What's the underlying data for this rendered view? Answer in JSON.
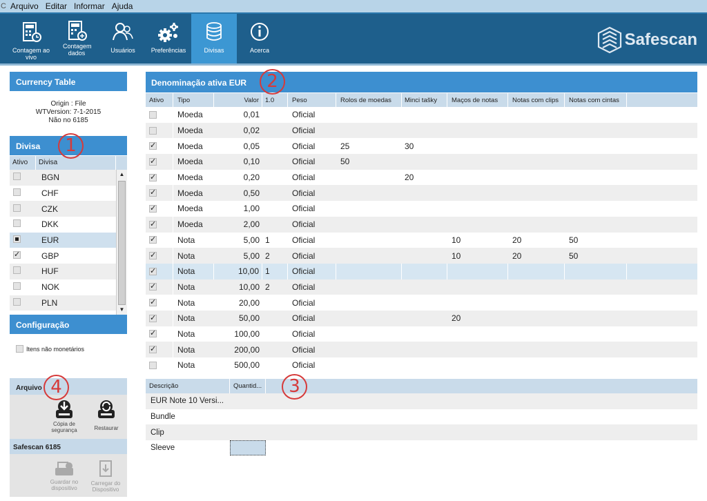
{
  "menu": {
    "left_fragment": "C",
    "items": [
      "Arquivo",
      "Editar",
      "Informar",
      "Ajuda"
    ]
  },
  "toolbar": {
    "buttons": [
      {
        "label": "Contagem ao vivo",
        "icon": "calculator-clock-icon"
      },
      {
        "label": "Contagem dados",
        "icon": "calculator-plus-icon"
      },
      {
        "label": "Usuários",
        "icon": "users-icon"
      },
      {
        "label": "Preferências",
        "icon": "gears-icon"
      },
      {
        "label": "Divisas",
        "icon": "coin-stack-icon",
        "active": true
      },
      {
        "label": "Acerca",
        "icon": "info-icon"
      }
    ],
    "logo": "Safescan"
  },
  "left": {
    "currency_table_title": "Currency Table",
    "origin": "Origin : File",
    "wtversion": "WTVersion: 7-1-2015",
    "serial": "Não no 6185",
    "divisa_title": "Divisa",
    "divisa_headers": [
      "Ativo",
      "Divisa"
    ],
    "divisas": [
      {
        "code": "BGN",
        "state": "off"
      },
      {
        "code": "CHF",
        "state": "off"
      },
      {
        "code": "CZK",
        "state": "off"
      },
      {
        "code": "DKK",
        "state": "off"
      },
      {
        "code": "EUR",
        "state": "square"
      },
      {
        "code": "GBP",
        "state": "on"
      },
      {
        "code": "HUF",
        "state": "off"
      },
      {
        "code": "NOK",
        "state": "off"
      },
      {
        "code": "PLN",
        "state": "off"
      }
    ],
    "config_title": "Configuração",
    "config_item": "Itens não monetários",
    "arquivo_title": "Arquivo",
    "backup_label": "Cópia de segurança",
    "restore_label": "Restaurar",
    "device_title": "Safescan 6185",
    "save_device_label": "Guardar no dispositivo",
    "load_device_label": "Carregar do Dispositivo"
  },
  "denom": {
    "title": "Denominação ativa EUR",
    "headers": [
      "Ativo",
      "Tipo",
      "Valor",
      "1.0",
      "Peso",
      "Rolos de moedas",
      "Minci tašky",
      "Maços de notas",
      "Notas com clips",
      "Notas com cintas"
    ],
    "rows": [
      {
        "active": false,
        "tipo": "Moeda",
        "valor": "0,01",
        "v10": "",
        "peso": "Oficial",
        "rolos": "",
        "minci": "",
        "macos": "",
        "clips": "",
        "cintas": ""
      },
      {
        "active": false,
        "tipo": "Moeda",
        "valor": "0,02",
        "v10": "",
        "peso": "Oficial",
        "rolos": "",
        "minci": "",
        "macos": "",
        "clips": "",
        "cintas": ""
      },
      {
        "active": true,
        "tipo": "Moeda",
        "valor": "0,05",
        "v10": "",
        "peso": "Oficial",
        "rolos": "25",
        "minci": "30",
        "macos": "",
        "clips": "",
        "cintas": ""
      },
      {
        "active": true,
        "tipo": "Moeda",
        "valor": "0,10",
        "v10": "",
        "peso": "Oficial",
        "rolos": "50",
        "minci": "",
        "macos": "",
        "clips": "",
        "cintas": ""
      },
      {
        "active": true,
        "tipo": "Moeda",
        "valor": "0,20",
        "v10": "",
        "peso": "Oficial",
        "rolos": "",
        "minci": "20",
        "macos": "",
        "clips": "",
        "cintas": ""
      },
      {
        "active": true,
        "tipo": "Moeda",
        "valor": "0,50",
        "v10": "",
        "peso": "Oficial",
        "rolos": "",
        "minci": "",
        "macos": "",
        "clips": "",
        "cintas": ""
      },
      {
        "active": true,
        "tipo": "Moeda",
        "valor": "1,00",
        "v10": "",
        "peso": "Oficial",
        "rolos": "",
        "minci": "",
        "macos": "",
        "clips": "",
        "cintas": ""
      },
      {
        "active": true,
        "tipo": "Moeda",
        "valor": "2,00",
        "v10": "",
        "peso": "Oficial",
        "rolos": "",
        "minci": "",
        "macos": "",
        "clips": "",
        "cintas": ""
      },
      {
        "active": true,
        "tipo": "Nota",
        "valor": "5,00",
        "v10": "1",
        "peso": "Oficial",
        "rolos": "",
        "minci": "",
        "macos": "10",
        "clips": "20",
        "cintas": "50"
      },
      {
        "active": true,
        "tipo": "Nota",
        "valor": "5,00",
        "v10": "2",
        "peso": "Oficial",
        "rolos": "",
        "minci": "",
        "macos": "10",
        "clips": "20",
        "cintas": "50"
      },
      {
        "active": true,
        "tipo": "Nota",
        "valor": "10,00",
        "v10": "1",
        "peso": "Oficial",
        "rolos": "",
        "minci": "",
        "macos": "",
        "clips": "",
        "cintas": "",
        "selected": true
      },
      {
        "active": true,
        "tipo": "Nota",
        "valor": "10,00",
        "v10": "2",
        "peso": "Oficial",
        "rolos": "",
        "minci": "",
        "macos": "",
        "clips": "",
        "cintas": ""
      },
      {
        "active": true,
        "tipo": "Nota",
        "valor": "20,00",
        "v10": "",
        "peso": "Oficial",
        "rolos": "",
        "minci": "",
        "macos": "",
        "clips": "",
        "cintas": ""
      },
      {
        "active": true,
        "tipo": "Nota",
        "valor": "50,00",
        "v10": "",
        "peso": "Oficial",
        "rolos": "",
        "minci": "",
        "macos": "20",
        "clips": "",
        "cintas": ""
      },
      {
        "active": true,
        "tipo": "Nota",
        "valor": "100,00",
        "v10": "",
        "peso": "Oficial",
        "rolos": "",
        "minci": "",
        "macos": "",
        "clips": "",
        "cintas": ""
      },
      {
        "active": true,
        "tipo": "Nota",
        "valor": "200,00",
        "v10": "",
        "peso": "Oficial",
        "rolos": "",
        "minci": "",
        "macos": "",
        "clips": "",
        "cintas": ""
      },
      {
        "active": false,
        "tipo": "Nota",
        "valor": "500,00",
        "v10": "",
        "peso": "Oficial",
        "rolos": "",
        "minci": "",
        "macos": "",
        "clips": "",
        "cintas": ""
      }
    ]
  },
  "sub": {
    "headers": [
      "Descrição",
      "Quantid..."
    ],
    "rows": [
      {
        "desc": "EUR Note 10 Versi...",
        "qty": ""
      },
      {
        "desc": "Bundle",
        "qty": ""
      },
      {
        "desc": "Clip",
        "qty": ""
      },
      {
        "desc": "Sleeve",
        "qty": "",
        "editing": true
      }
    ]
  },
  "markers": [
    "1",
    "2",
    "3",
    "4"
  ],
  "colors": {
    "accent": "#3d8fd0",
    "toolbar": "#1e5f8c",
    "marker": "#d63a3a"
  }
}
